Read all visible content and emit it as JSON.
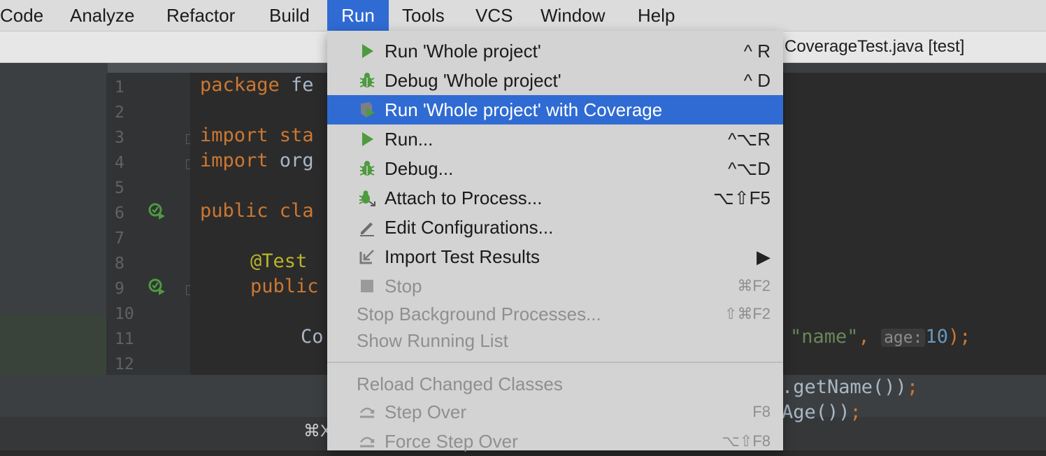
{
  "menubar": {
    "items": [
      "Code",
      "Analyze",
      "Refactor",
      "Build",
      "Run",
      "Tools",
      "VCS",
      "Window",
      "Help"
    ],
    "active": "Run"
  },
  "window": {
    "title": "CoverageTest.java [test]"
  },
  "editor": {
    "line_numbers": [
      "1",
      "2",
      "3",
      "4",
      "5",
      "6",
      "7",
      "8",
      "9",
      "10",
      "11",
      "12"
    ],
    "code": {
      "l1_kw": "package",
      "l1_rest": " fe",
      "l3_kw": "import",
      "l3_rest": " sta",
      "l4_kw": "import",
      "l4_rest": " org",
      "l6_kw": "public",
      "l6_rest": " cla",
      "l8_ann": "@Test",
      "l9_kw": "public",
      "l11_txt": "Co",
      "l11_str": "\"name\"",
      "l11_comma": ",",
      "l11_hint": "age:",
      "l11_num": "10",
      "l11_end": ");",
      "l13_a": ".getName())",
      "l13_b": ";",
      "l14_a": "Age())",
      "l14_b": ";"
    }
  },
  "bottom": {
    "shortcut_fragment": "⌘X"
  },
  "run_menu": {
    "items": [
      {
        "label": "Run 'Whole project'",
        "shortcut": "^ R",
        "icon": "run-icon"
      },
      {
        "label": "Debug 'Whole project'",
        "shortcut": "^ D",
        "icon": "debug-icon"
      },
      {
        "label": "Run 'Whole project' with Coverage",
        "shortcut": "",
        "icon": "coverage-icon",
        "selected": true
      },
      {
        "label": "Run...",
        "shortcut": "^⌥R",
        "icon": "run-icon"
      },
      {
        "label": "Debug...",
        "shortcut": "^⌥D",
        "icon": "debug-icon"
      },
      {
        "label": "Attach to Process...",
        "shortcut": "⌥⇧F5",
        "icon": "attach-icon"
      },
      {
        "label": "Edit Configurations...",
        "shortcut": "",
        "icon": "edit-icon"
      },
      {
        "label": "Import Test Results",
        "shortcut": "▶",
        "icon": "import-icon"
      },
      {
        "label": "Stop",
        "shortcut": "⌘F2",
        "icon": "stop-icon",
        "disabled": true
      },
      {
        "label": "Stop Background Processes...",
        "shortcut": "⇧⌘F2",
        "disabled": true
      },
      {
        "label": "Show Running List",
        "shortcut": "",
        "disabled": true
      },
      {
        "label": "Reload Changed Classes",
        "shortcut": "",
        "disabled": true
      },
      {
        "label": "Step Over",
        "shortcut": "F8",
        "icon": "step-over-icon",
        "disabled": true
      },
      {
        "label": "Force Step Over",
        "shortcut": "⌥⇧F8",
        "icon": "force-step-over-icon",
        "disabled": true
      }
    ]
  },
  "colors": {
    "accent": "#2f6bd3",
    "run_green": "#4e9a3f"
  }
}
